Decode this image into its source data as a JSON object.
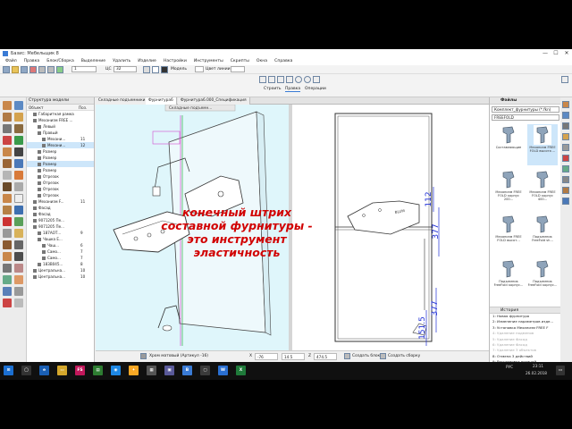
{
  "window": {
    "title": "Базис: Мебельщик 8",
    "controls": {
      "minimize": "—",
      "maximize": "☐",
      "close": "✕"
    }
  },
  "menu": [
    "Файл",
    "Правка",
    "Блок/Сборка",
    "Выделение",
    "Удалить",
    "Изделие",
    "Настройки",
    "Инструменты",
    "Скрипты",
    "Окна",
    "Справка"
  ],
  "toolbar": {
    "layer_value": "1",
    "color_label": "ЦС",
    "color_value": "32",
    "mode_label": "Модель",
    "line_color_label": "Цвет линии",
    "build_label": "Строить",
    "edit_label": "Правка",
    "operations_label": "Операции"
  },
  "tree": {
    "header": "Структура модели",
    "col_object": "Объект",
    "col_pos": "Поз.",
    "rows": [
      {
        "label": "Габаритная рамка",
        "num": "",
        "indent": 1,
        "sel": false
      },
      {
        "label": "Механизм FREE ...",
        "num": "",
        "indent": 1,
        "sel": false
      },
      {
        "label": "Левый",
        "num": "",
        "indent": 2,
        "sel": false
      },
      {
        "label": "Правый",
        "num": "",
        "indent": 2,
        "sel": false
      },
      {
        "label": "Механи...",
        "num": "11",
        "indent": 3,
        "sel": false
      },
      {
        "label": "Механи...",
        "num": "12",
        "indent": 3,
        "sel": true
      },
      {
        "label": "Размер",
        "num": "",
        "indent": 2,
        "sel": false
      },
      {
        "label": "Размер",
        "num": "",
        "indent": 2,
        "sel": false
      },
      {
        "label": "Размер",
        "num": "",
        "indent": 2,
        "sel": true
      },
      {
        "label": "Размер",
        "num": "",
        "indent": 2,
        "sel": false
      },
      {
        "label": "Отрезок",
        "num": "",
        "indent": 2,
        "sel": false
      },
      {
        "label": "Отрезок",
        "num": "",
        "indent": 2,
        "sel": false
      },
      {
        "label": "Отрезок",
        "num": "",
        "indent": 2,
        "sel": false
      },
      {
        "label": "Отрезок",
        "num": "",
        "indent": 2,
        "sel": false
      },
      {
        "label": "Механизм F...",
        "num": "11",
        "indent": 1,
        "sel": false
      },
      {
        "label": "Фасад",
        "num": "",
        "indent": 1,
        "sel": false
      },
      {
        "label": "Фасад",
        "num": "",
        "indent": 1,
        "sel": false
      },
      {
        "label": "9071205 Пе...",
        "num": "",
        "indent": 1,
        "sel": false
      },
      {
        "label": "9071205 Пе...",
        "num": "",
        "indent": 1,
        "sel": false
      },
      {
        "label": "187АОТ...",
        "num": "9",
        "indent": 2,
        "sel": false
      },
      {
        "label": "Чашка Е...",
        "num": "",
        "indent": 2,
        "sel": false
      },
      {
        "label": "Чаш...",
        "num": "6",
        "indent": 3,
        "sel": false
      },
      {
        "label": "Само...",
        "num": "7",
        "indent": 3,
        "sel": false
      },
      {
        "label": "Само...",
        "num": "7",
        "indent": 3,
        "sel": false
      },
      {
        "label": "183В045...",
        "num": "8",
        "indent": 2,
        "sel": false
      },
      {
        "label": "Центральна...",
        "num": "10",
        "indent": 1,
        "sel": false
      },
      {
        "label": "Центральна...",
        "num": "10",
        "indent": 1,
        "sel": false
      }
    ]
  },
  "view_tabs": [
    "Складные подъемники",
    "Фурнитура6",
    "Фурнитура6.000_Спецификация"
  ],
  "doc_tab": "Складные подъемн...",
  "dimensions": {
    "top": "112",
    "middle": "377",
    "bottom_a": "377",
    "bottom_b": "151.5"
  },
  "overlay": {
    "line1": "конечный штрих",
    "line2": "составной фурнитуры -",
    "line3": "это инструмент",
    "line4": "эластичность"
  },
  "statusbar": {
    "material": "Хром матовый (Артикул -16)",
    "x_label": "X",
    "x_value": "-76",
    "y_value": "14.5",
    "z_label": "Z",
    "z_value": "474.5",
    "create_block": "Создать блок",
    "create_assembly": "Создать сборку"
  },
  "files": {
    "header": "Файлы",
    "path": "Комплект_фурнитуры (*.fkn)",
    "filter": "FREEFOLD",
    "tiles": [
      {
        "label": "Составляющие",
        "sel": false
      },
      {
        "label": "Механизм FREE FOLD высота ...",
        "sel": true
      },
      {
        "label": "Механизм FREE FOLD корпус 200...",
        "sel": false
      },
      {
        "label": "Механизм FREE FOLD корпус 400...",
        "sel": false
      },
      {
        "label": "Механизм FREE FOLD высот...",
        "sel": false
      },
      {
        "label": "Подъемник FreeFold sh...",
        "sel": false
      },
      {
        "label": "Подъемник FreeFold корпус...",
        "sel": false
      },
      {
        "label": "Подъемник FreeFold корпус...",
        "sel": false
      }
    ]
  },
  "history": {
    "header": "История",
    "items": [
      {
        "text": "1: Новая фурнитура",
        "dim": false
      },
      {
        "text": "2: Изменение параметров изде...",
        "dim": false
      },
      {
        "text": "3: Установка Механизм FREE F",
        "dim": false
      },
      {
        "text": "4: Удаление подменов",
        "dim": true
      },
      {
        "text": "5: Удаление Фасад",
        "dim": true
      },
      {
        "text": "6: Удаление Фасад",
        "dim": true
      },
      {
        "text": "7: Удаление 3 объектов",
        "dim": true
      },
      {
        "text": "8: Отмена 3 действий",
        "dim": false
      },
      {
        "text": "9: Расстановка позиций",
        "dim": false
      },
      {
        "text": "10: Редактирование параметра",
        "dim": false
      }
    ]
  },
  "taskbar": {
    "lang": "РУС",
    "time": "23:11",
    "date": "26.02.2018"
  },
  "colors": {
    "overlay_text": "#d10000",
    "dimension": "#1f2fd6",
    "selection": "#cde6fa",
    "drawing": "#333333"
  }
}
